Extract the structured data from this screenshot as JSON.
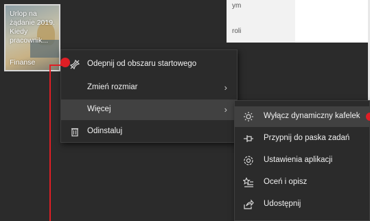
{
  "background_text": [
    "ym",
    "roli"
  ],
  "tile": {
    "title": "Urlop na żądanie 2019. Kiedy pracownik...",
    "group": "Finanse"
  },
  "context_menu": {
    "items": [
      {
        "label": "Odepnij od obszaru startowego",
        "icon": "unpin-icon"
      },
      {
        "label": "Zmień rozmiar",
        "has_submenu": true
      },
      {
        "label": "Więcej",
        "has_submenu": true,
        "highlighted": true
      },
      {
        "label": "Odinstaluj",
        "icon": "trash-icon"
      }
    ]
  },
  "submenu": {
    "items": [
      {
        "label": "Wyłącz dynamiczny kafelek",
        "icon": "sun-icon",
        "highlighted": true
      },
      {
        "label": "Przypnij do paska zadań",
        "icon": "pin-taskbar-icon"
      },
      {
        "label": "Ustawienia aplikacji",
        "icon": "gear-icon"
      },
      {
        "label": "Oceń i opisz",
        "icon": "star-list-icon"
      },
      {
        "label": "Udostępnij",
        "icon": "share-icon"
      }
    ]
  },
  "colors": {
    "background": "#2b2b2b",
    "menu": "#2b2b2b",
    "highlight": "#414141",
    "marker": "#e01e25"
  }
}
